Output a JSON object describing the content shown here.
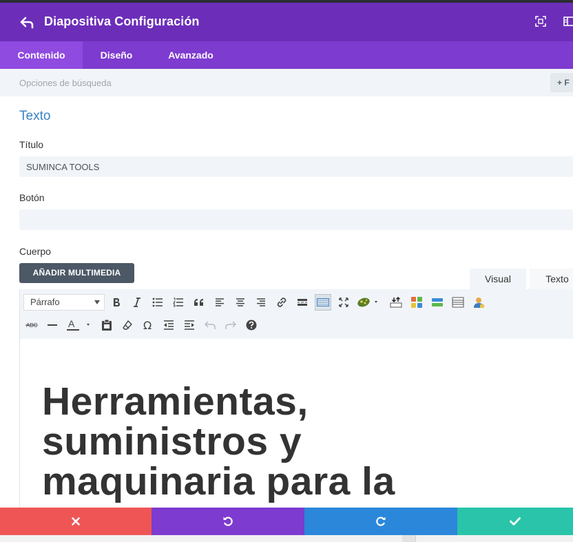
{
  "header": {
    "title": "Diapositiva Configuración"
  },
  "tabs": [
    {
      "label": "Contenido",
      "active": true
    },
    {
      "label": "Diseño",
      "active": false
    },
    {
      "label": "Avanzado",
      "active": false
    }
  ],
  "search": {
    "label": "Opciones de búsqueda",
    "filter_button": "+ F"
  },
  "section": {
    "title": "Texto"
  },
  "fields": {
    "title_label": "Título",
    "title_value": "SUMINCA TOOLS",
    "button_label": "Botón",
    "button_value": "",
    "body_label": "Cuerpo"
  },
  "editor": {
    "media_button": "AÑADIR MULTIMEDIA",
    "tab_visual": "Visual",
    "tab_text": "Texto",
    "format_select": "Párrafo",
    "content_heading": "Herramientas, suministros y maquinaria para la"
  },
  "colors": {
    "header": "#6c2eb9",
    "tabs": "#7d3bcf",
    "active_tab": "#8f4ae0",
    "cancel": "#ef5555",
    "undo": "#7d3bcf",
    "redo": "#2b87da",
    "save": "#29c4a9"
  }
}
